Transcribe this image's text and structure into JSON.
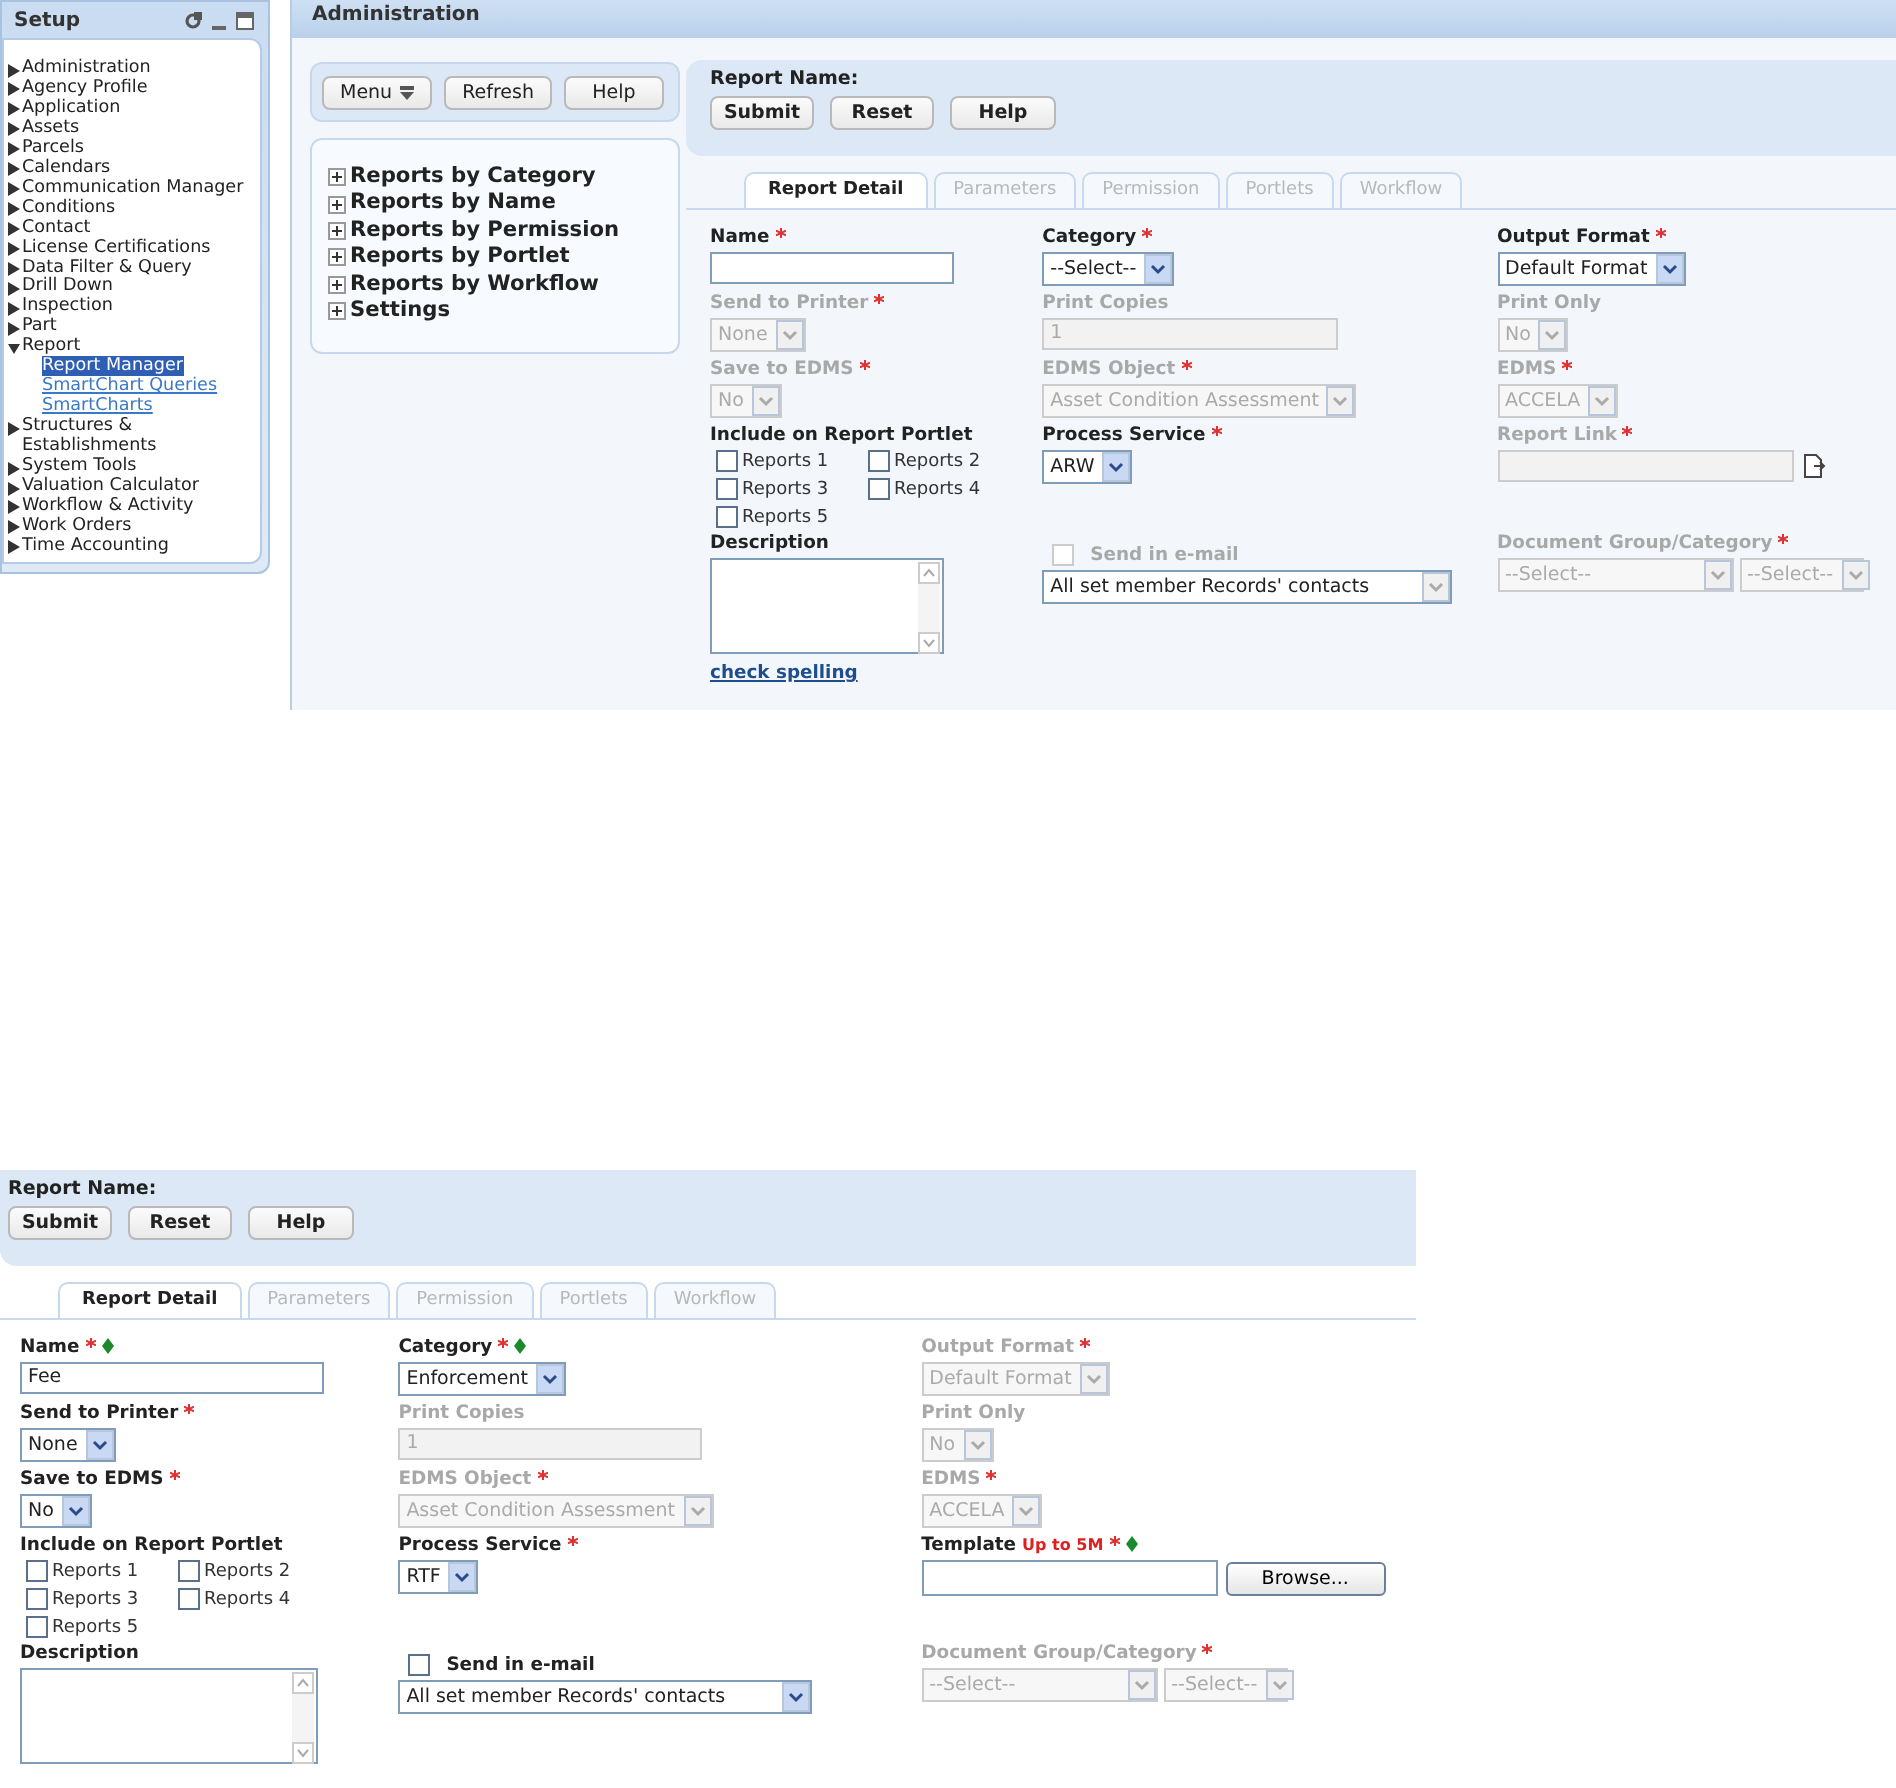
{
  "setup": {
    "title": "Setup",
    "items": [
      {
        "label": "Administration",
        "expanded": false
      },
      {
        "label": "Agency Profile",
        "expanded": false
      },
      {
        "label": "Application",
        "expanded": false
      },
      {
        "label": "Assets",
        "expanded": false
      },
      {
        "label": "Parcels",
        "expanded": false
      },
      {
        "label": "Calendars",
        "expanded": false
      },
      {
        "label": "Communication Manager",
        "expanded": false
      },
      {
        "label": "Conditions",
        "expanded": false
      },
      {
        "label": "Contact",
        "expanded": false
      },
      {
        "label": "License Certifications",
        "expanded": false
      },
      {
        "label": "Data Filter & Query",
        "expanded": false
      },
      {
        "label": "Drill Down",
        "expanded": false
      },
      {
        "label": "Inspection",
        "expanded": false
      },
      {
        "label": "Part",
        "expanded": false
      },
      {
        "label": "Report",
        "expanded": true,
        "children": [
          {
            "label": "Report Manager",
            "selected": true
          },
          {
            "label": "SmartChart Queries",
            "selected": false
          },
          {
            "label": "SmartCharts",
            "selected": false
          }
        ]
      },
      {
        "label": "Structures & Establishments",
        "expanded": false
      },
      {
        "label": "System Tools",
        "expanded": false
      },
      {
        "label": "Valuation Calculator",
        "expanded": false
      },
      {
        "label": "Workflow & Activity",
        "expanded": false
      },
      {
        "label": "Work Orders",
        "expanded": false
      },
      {
        "label": "Time Accounting",
        "expanded": false
      }
    ]
  },
  "administration": {
    "title": "Administration",
    "toolbar": [
      {
        "label": "Menu",
        "kind": "menu"
      },
      {
        "label": "Refresh",
        "kind": "button"
      },
      {
        "label": "Help",
        "kind": "button"
      }
    ],
    "tree": [
      {
        "label": "Reports by Category",
        "expanded": false
      },
      {
        "label": "Reports by Name",
        "expanded": false
      },
      {
        "label": "Reports by Permission",
        "expanded": false
      },
      {
        "label": "Reports by Portlet",
        "expanded": false
      },
      {
        "label": "Reports by Workflow",
        "expanded": false
      },
      {
        "label": "Settings",
        "expanded": false
      }
    ]
  },
  "reports": [
    {
      "title": "Report Name:",
      "buttons": [
        "Submit",
        "Reset",
        "Help"
      ],
      "tabs": [
        {
          "label": "Report Detail",
          "selected": true,
          "disabled": false
        },
        {
          "label": "Parameters",
          "selected": false,
          "disabled": true
        },
        {
          "label": "Permission",
          "selected": false,
          "disabled": true
        },
        {
          "label": "Portlets",
          "selected": false,
          "disabled": true
        },
        {
          "label": "Workflow",
          "selected": false,
          "disabled": true
        }
      ],
      "rows": [
        [
          {
            "kind": "text",
            "label": "Name",
            "required": true,
            "disabled": false
          },
          {
            "kind": "select",
            "label": "Category",
            "required": true,
            "disabled": false,
            "value": "--Select--"
          },
          {
            "kind": "select",
            "label": "Output Format",
            "required": true,
            "disabled": false,
            "value": "Default Format"
          }
        ],
        [
          {
            "kind": "select",
            "label": "Send to Printer",
            "required": true,
            "disabled": true,
            "value": "None"
          },
          {
            "kind": "text",
            "label": "Print Copies",
            "disabled": true,
            "value": "1"
          },
          {
            "kind": "select",
            "label": "Print Only",
            "disabled": true,
            "value": "No"
          }
        ],
        [
          {
            "kind": "select",
            "label": "Save to EDMS",
            "required": true,
            "disabled": true,
            "value": "No"
          },
          {
            "kind": "select",
            "label": "EDMS Object",
            "required": true,
            "disabled": true,
            "value": "Asset Condition Assessment"
          },
          {
            "kind": "select",
            "label": "EDMS",
            "required": true,
            "disabled": true,
            "value": "ACCELA"
          }
        ],
        [
          {
            "kind": "checks",
            "label": "Include on Report Portlet",
            "items": [
              {
                "label": "Reports 1",
                "checked": false
              },
              {
                "label": "Reports 2",
                "checked": false
              },
              {
                "label": "Reports 3",
                "checked": false
              },
              {
                "label": "Reports 4",
                "checked": false
              },
              {
                "label": "Reports 5",
                "checked": false
              }
            ]
          },
          {
            "kind": "select",
            "label": "Process Service",
            "required": true,
            "disabled": false,
            "value": "ARW"
          },
          {
            "kind": "link",
            "label": "Report Link",
            "required": true,
            "disabled": true
          }
        ],
        [
          {
            "kind": "textarea",
            "label": "Description",
            "link": "check spelling"
          },
          {
            "kind": "email",
            "label": "Send in e-mail",
            "checked": false,
            "disabled": true,
            "value": "All set member Records' contacts"
          },
          {
            "kind": "pair",
            "label": "Document Group/Category",
            "required": true,
            "disabled": true,
            "values": [
              "--Select--",
              "--Select--"
            ]
          }
        ]
      ]
    },
    {
      "title": "Report Name:",
      "buttons": [
        "Submit",
        "Reset",
        "Help"
      ],
      "tabs": [
        {
          "label": "Report Detail",
          "selected": true,
          "disabled": false
        },
        {
          "label": "Parameters",
          "selected": false,
          "disabled": true
        },
        {
          "label": "Permission",
          "selected": false,
          "disabled": true
        },
        {
          "label": "Portlets",
          "selected": false,
          "disabled": true
        },
        {
          "label": "Workflow",
          "selected": false,
          "disabled": true
        }
      ],
      "rows": [
        [
          {
            "kind": "text",
            "label": "Name",
            "required": true,
            "marked": true,
            "disabled": false,
            "value": "Fee"
          },
          {
            "kind": "select",
            "label": "Category",
            "required": true,
            "marked": true,
            "disabled": false,
            "value": "Enforcement"
          },
          {
            "kind": "select",
            "label": "Output Format",
            "required": true,
            "disabled": true,
            "value": "Default Format"
          }
        ],
        [
          {
            "kind": "select",
            "label": "Send to Printer",
            "required": true,
            "disabled": false,
            "value": "None"
          },
          {
            "kind": "text",
            "label": "Print Copies",
            "disabled": true,
            "value": "1"
          },
          {
            "kind": "select",
            "label": "Print Only",
            "disabled": true,
            "value": "No"
          }
        ],
        [
          {
            "kind": "select",
            "label": "Save to EDMS",
            "required": true,
            "disabled": false,
            "value": "No"
          },
          {
            "kind": "select",
            "label": "EDMS Object",
            "required": true,
            "disabled": true,
            "value": "Asset Condition Assessment"
          },
          {
            "kind": "select",
            "label": "EDMS",
            "required": true,
            "disabled": true,
            "value": "ACCELA"
          }
        ],
        [
          {
            "kind": "checks",
            "label": "Include on Report Portlet",
            "items": [
              {
                "label": "Reports 1",
                "checked": false
              },
              {
                "label": "Reports 2",
                "checked": false
              },
              {
                "label": "Reports 3",
                "checked": false
              },
              {
                "label": "Reports 4",
                "checked": false
              },
              {
                "label": "Reports 5",
                "checked": false
              }
            ]
          },
          {
            "kind": "select",
            "label": "Process Service",
            "required": true,
            "disabled": false,
            "value": "RTF"
          },
          {
            "kind": "file",
            "label": "Template",
            "note": "Up to 5M",
            "required": true,
            "marked": true,
            "disabled": false,
            "button": "Browse..."
          }
        ],
        [
          {
            "kind": "textarea",
            "label": "Description"
          },
          {
            "kind": "email",
            "label": "Send in e-mail",
            "checked": false,
            "disabled": false,
            "value": "All set member Records' contacts"
          },
          {
            "kind": "pair",
            "label": "Document Group/Category",
            "required": true,
            "disabled": true,
            "values": [
              "--Select--",
              "--Select--"
            ]
          }
        ]
      ]
    }
  ]
}
